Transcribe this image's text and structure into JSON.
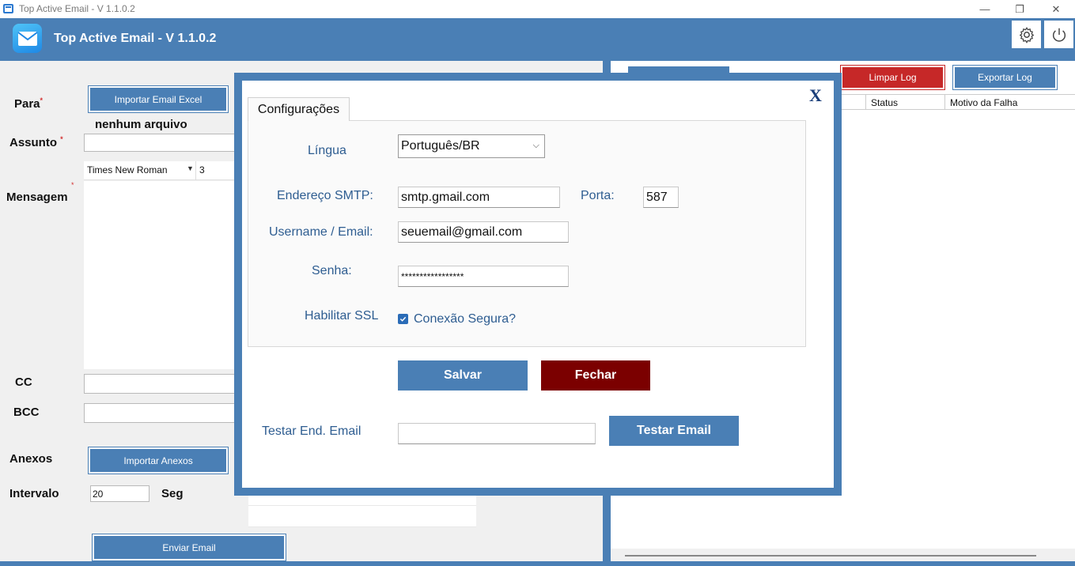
{
  "window": {
    "title": "Top Active Email - V 1.1.0.2",
    "minimize": "—",
    "maximize": "❐",
    "close": "✕"
  },
  "header": {
    "title": "Top Active Email - V 1.1.0.2",
    "settings_icon": "gear-icon",
    "power_icon": "power-icon"
  },
  "compose": {
    "para_label": "Para",
    "required_mark": "*",
    "import_excel_button": "Importar Email Excel",
    "no_file_text": "nenhum arquivo",
    "assunto_label": "Assunto",
    "assunto_value": "",
    "font_name": "Times New Roman",
    "font_size": "3",
    "mensagem_label": "Mensagem",
    "cc_label": "CC",
    "bcc_label": "BCC",
    "anexos_label": "Anexos",
    "import_attachments_button": "Importar Anexos",
    "intervalo_label": "Intervalo",
    "intervalo_value": "20",
    "seg_label": "Seg",
    "send_button": "Enviar Email"
  },
  "log": {
    "clear_button": "Limpar Log",
    "export_button": "Exportar Log",
    "columns": [
      "Status",
      "Motivo da Falha"
    ]
  },
  "settings_dialog": {
    "close_label": "X",
    "tab_label": "Configurações",
    "language_label": "Língua",
    "language_value": "Português/BR",
    "smtp_label": "Endereço SMTP:",
    "smtp_value": "smtp.gmail.com",
    "port_label": "Porta:",
    "port_value": "587",
    "username_label": "Username / Email:",
    "username_value": "seuemail@gmail.com",
    "password_label": "Senha:",
    "password_value": "*****************",
    "ssl_label": "Habilitar SSL",
    "ssl_checkbox_label": "Conexão Segura?",
    "save_button": "Salvar",
    "close_button": "Fechar",
    "test_label": "Testar End. Email",
    "test_value": "",
    "test_button": "Testar Email"
  },
  "colors": {
    "primary": "#4a7fb5",
    "danger": "#c62828",
    "dark_red": "#7b0000",
    "label_blue": "#2e5d91"
  }
}
